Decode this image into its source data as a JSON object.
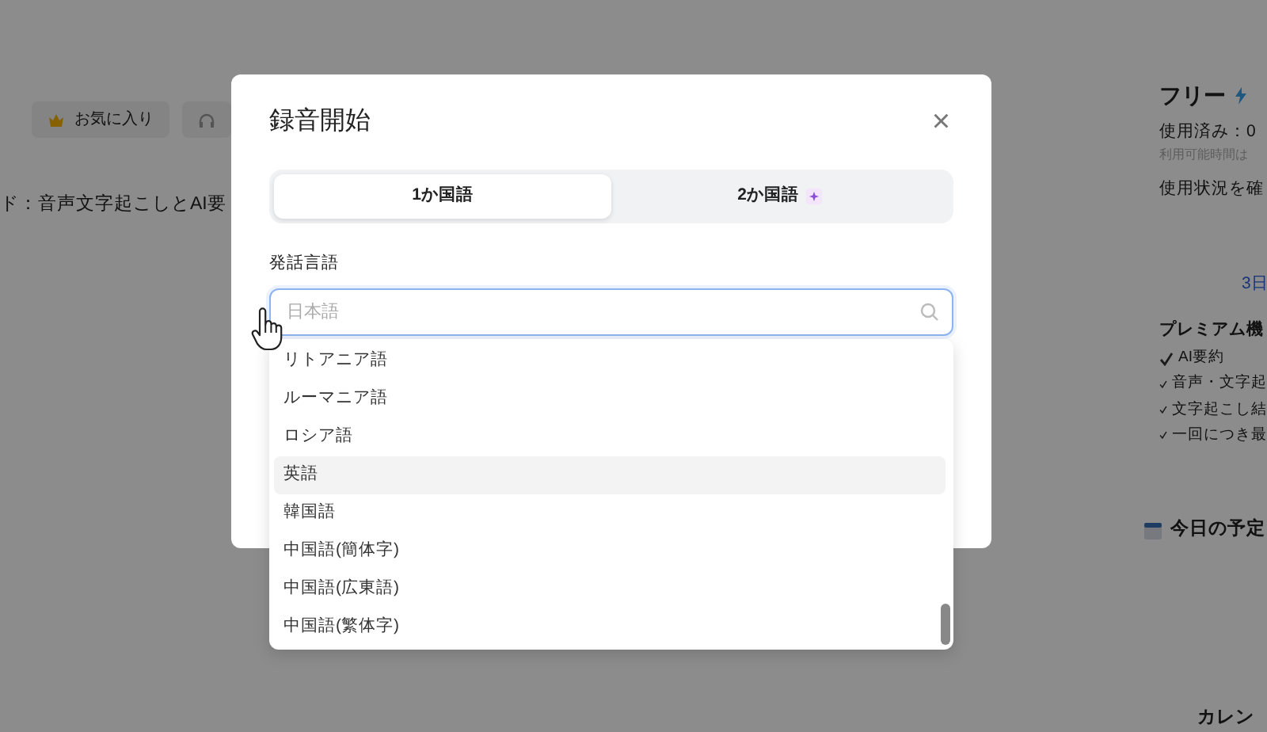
{
  "background": {
    "toolbar_chips": [
      {
        "label": "お気に入り",
        "kind": "favorite"
      },
      {
        "kind": "headphones"
      }
    ],
    "heading": "ド：音声文字起こしとAI要",
    "plan_card": {
      "title": "フリー",
      "usage": "使用済み：0",
      "available": "利用可能時間は",
      "check_usage": "使用状況を確",
      "days_link": "3日",
      "premium_title": "プレミアム機",
      "premium_features": [
        "AI要約",
        "音声・文字起",
        "文字起こし結",
        "一回につき最"
      ]
    },
    "schedule_title": "今日の予定",
    "calendar_title": "カレン"
  },
  "dialog": {
    "title": "録音開始",
    "close": "×",
    "tabs": [
      {
        "label": "1か国語",
        "selected": true,
        "premium": false
      },
      {
        "label": "2か国語",
        "selected": false,
        "premium": true
      }
    ],
    "field_label": "発話言語",
    "search": {
      "placeholder": "日本語"
    },
    "options": [
      {
        "label": "リトアニア語",
        "hovered": false
      },
      {
        "label": "ルーマニア語",
        "hovered": false
      },
      {
        "label": "ロシア語",
        "hovered": false
      },
      {
        "label": "英語",
        "hovered": true
      },
      {
        "label": "韓国語",
        "hovered": false
      },
      {
        "label": "中国語(簡体字)",
        "hovered": false
      },
      {
        "label": "中国語(広東語)",
        "hovered": false
      },
      {
        "label": "中国語(繁体字)",
        "hovered": false
      }
    ]
  }
}
